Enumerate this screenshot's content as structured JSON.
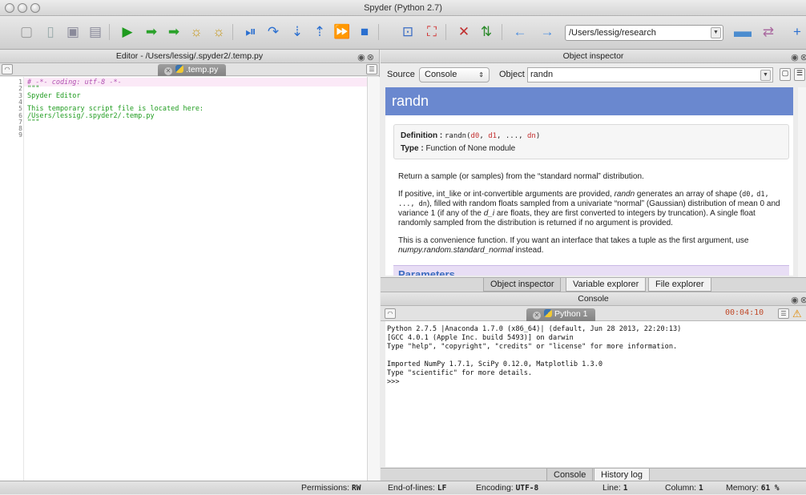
{
  "window": {
    "title": "Spyder (Python 2.7)"
  },
  "toolbar": {
    "path_value": "/Users/lessig/research",
    "icons": [
      "new-file-icon",
      "open-file-icon",
      "save-icon",
      "save-all-icon",
      "run-icon",
      "run-selection-icon",
      "run-again-icon",
      "debug-icon",
      "debug-run-icon",
      "debug-continue-icon",
      "step-icon",
      "step-into-icon",
      "step-return-icon",
      "continue-icon",
      "stop-icon",
      "maximize-pane-icon",
      "fullscreen-icon",
      "preferences-icon",
      "pythonpath-icon",
      "back-icon",
      "forward-icon",
      "browse-folder-icon",
      "parent-dir-icon"
    ]
  },
  "editor": {
    "title": "Editor - /Users/lessig/.spyder2/.temp.py",
    "tab_label": ".temp.py",
    "lines": [
      {
        "num": "1",
        "text": "# -*- coding: utf-8 -*-",
        "kind": "comment"
      },
      {
        "num": "2",
        "text": "\"\"\"",
        "kind": "string"
      },
      {
        "num": "3",
        "text": "Spyder Editor",
        "kind": "string"
      },
      {
        "num": "4",
        "text": "",
        "kind": "string"
      },
      {
        "num": "5",
        "text": "This temporary script file is located here:",
        "kind": "string"
      },
      {
        "num": "6",
        "text": "/Users/lessig/.spyder2/.temp.py",
        "kind": "string"
      },
      {
        "num": "7",
        "text": "\"\"\"",
        "kind": "string"
      },
      {
        "num": "8",
        "text": "",
        "kind": "string"
      },
      {
        "num": "9",
        "text": "",
        "kind": "string"
      }
    ]
  },
  "inspector": {
    "title": "Object inspector",
    "source_label": "Source",
    "source_value": "Console",
    "object_label": "Object",
    "object_value": "randn",
    "heading": "randn",
    "definition_label": "Definition :",
    "definition_name": "randn",
    "definition_args": [
      "d0",
      "d1",
      "...",
      "dn"
    ],
    "type_label": "Type :",
    "type_value": "Function of None module",
    "para1": "Return a sample (or samples) from the “standard normal” distribution.",
    "para2_a": "If positive, int_like or int-convertible arguments are provided, ",
    "para2_em": "randn",
    "para2_b": " generates an array of shape (",
    "para2_shape": "d0,",
    "para2_c": "d1, ..., dn",
    "para2_d": "), filled with random floats sampled from a univariate “normal” (Gaussian) distribution of mean 0 and variance 1 (if any of the ",
    "para2_di": "d_i",
    "para2_e": " are floats, they are first converted to integers by truncation). A single float randomly sampled from the distribution is returned if no argument is provided.",
    "para3_a": "This is a convenience function. If you want an interface that takes a tuple as the first argument, use ",
    "para3_em": "numpy.random.standard_normal",
    "para3_b": " instead.",
    "params_heading": "Parameters",
    "tabs": [
      "Object inspector",
      "Variable explorer",
      "File explorer"
    ],
    "selected_tab": "Object inspector"
  },
  "console": {
    "title": "Console",
    "tab_label": "Python 1",
    "elapsed": "00:04:10",
    "text": "Python 2.7.5 |Anaconda 1.7.0 (x86_64)| (default, Jun 28 2013, 22:20:13)\n[GCC 4.0.1 (Apple Inc. build 5493)] on darwin\nType \"help\", \"copyright\", \"credits\" or \"license\" for more information.\n\nImported NumPy 1.7.1, SciPy 0.12.0, Matplotlib 1.3.0\nType \"scientific\" for more details.\n>>>",
    "tabs": [
      "Console",
      "History log"
    ],
    "selected_tab": "Console"
  },
  "statusbar": {
    "permissions_label": "Permissions:",
    "permissions_value": "RW",
    "eol_label": "End-of-lines:",
    "eol_value": "LF",
    "encoding_label": "Encoding:",
    "encoding_value": "UTF-8",
    "line_label": "Line:",
    "line_value": "1",
    "column_label": "Column:",
    "column_value": "1",
    "memory_label": "Memory:",
    "memory_value": "61 %"
  },
  "colors": {
    "comment": "#b04fb0",
    "string": "#1f9c1f",
    "accent": "#6a88cf",
    "elapsed": "#c04a2a"
  }
}
